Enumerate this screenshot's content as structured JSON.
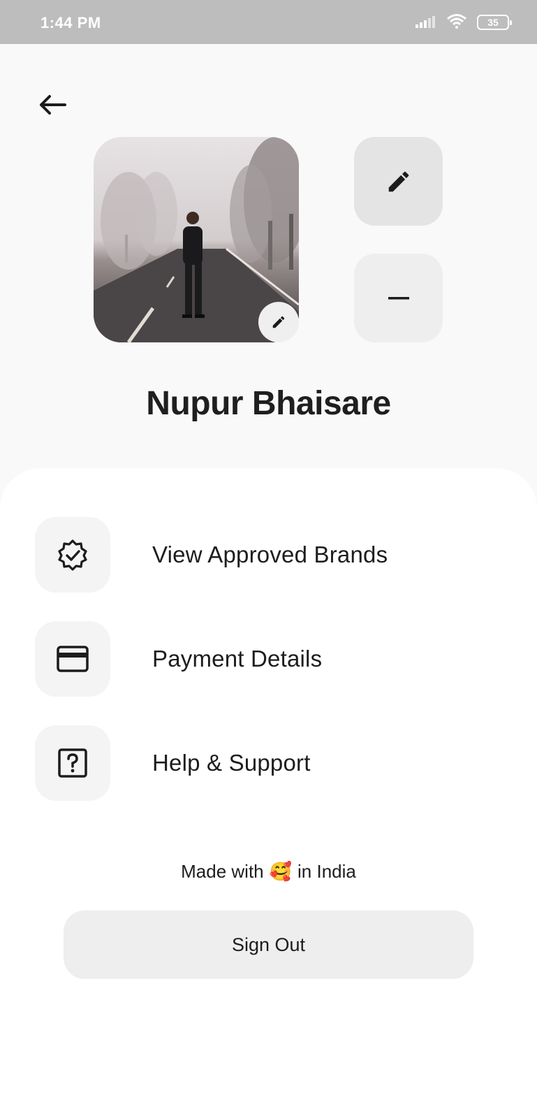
{
  "status_bar": {
    "time": "1:44 PM",
    "battery": "35"
  },
  "profile": {
    "name": "Nupur Bhaisare"
  },
  "menu": [
    {
      "label": "View Approved Brands",
      "icon": "verified-badge-icon"
    },
    {
      "label": "Payment Details",
      "icon": "credit-card-icon"
    },
    {
      "label": "Help & Support",
      "icon": "help-icon"
    }
  ],
  "footer": {
    "made_prefix": "Made with",
    "emoji": "🥰",
    "made_suffix": "in India"
  },
  "signout": {
    "label": "Sign Out"
  },
  "colors": {
    "status_bar": "#bdbdbd",
    "page_bg": "#f9f9f9",
    "sheet_bg": "#ffffff",
    "tile_bg": "#f4f4f4",
    "button_bg": "#eeeeee"
  }
}
